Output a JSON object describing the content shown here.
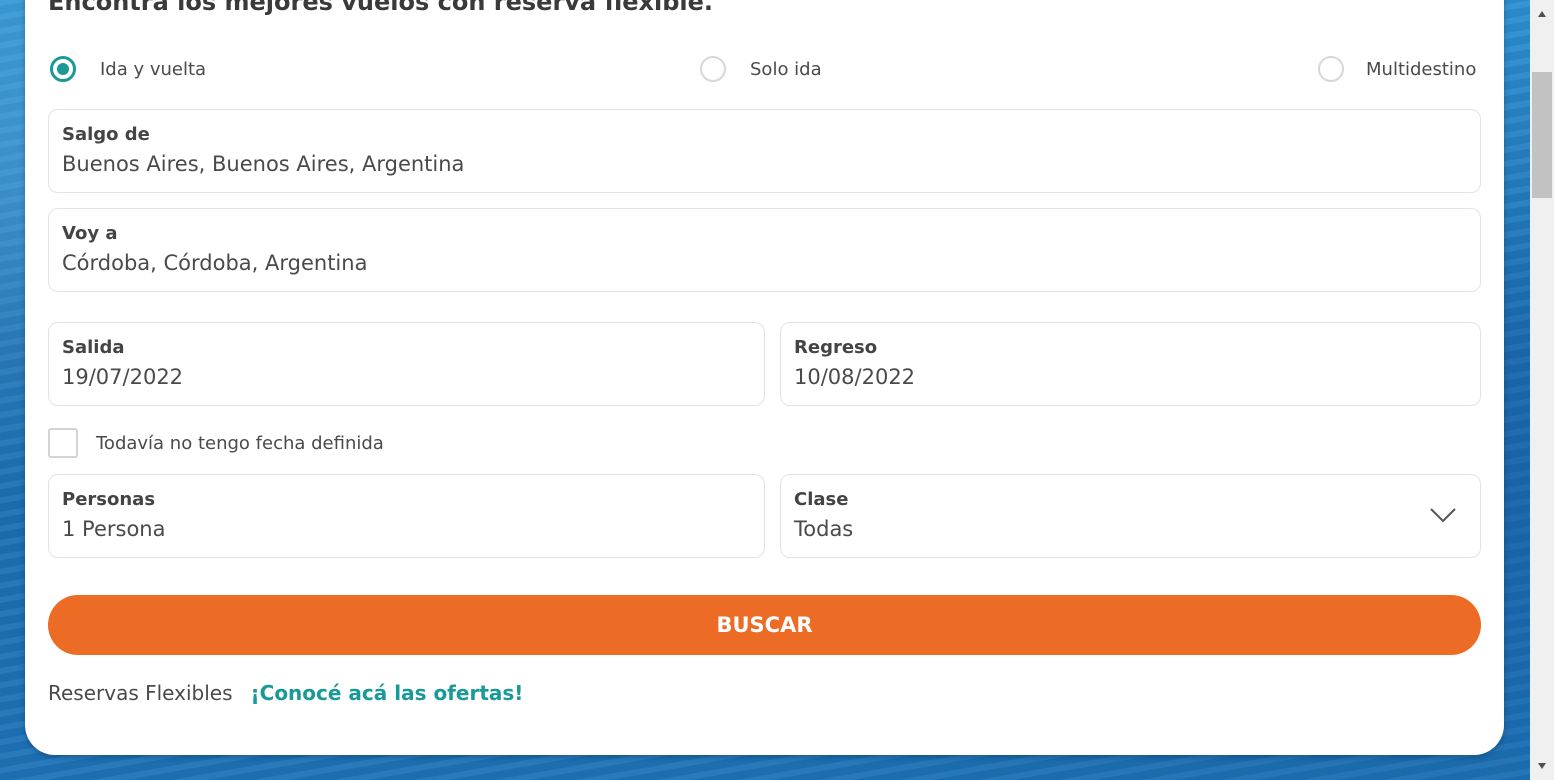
{
  "page": {
    "heading": "Encontrá los mejores vuelos con reserva flexible."
  },
  "trip_type": {
    "options": [
      {
        "label": "Ida y vuelta",
        "selected": true
      },
      {
        "label": "Solo ida",
        "selected": false
      },
      {
        "label": "Multidestino",
        "selected": false
      }
    ]
  },
  "form": {
    "origin": {
      "label": "Salgo de",
      "value": "Buenos Aires, Buenos Aires, Argentina"
    },
    "destination": {
      "label": "Voy a",
      "value": "Córdoba, Córdoba, Argentina"
    },
    "departure": {
      "label": "Salida",
      "value": "19/07/2022"
    },
    "return": {
      "label": "Regreso",
      "value": "10/08/2022"
    },
    "no_date": {
      "label": "Todavía no tengo fecha definida",
      "checked": false
    },
    "people": {
      "label": "Personas",
      "value": "1 Persona"
    },
    "class": {
      "label": "Clase",
      "value": "Todas"
    },
    "search_button": "BUSCAR"
  },
  "footer": {
    "text": "Reservas Flexibles",
    "link": "¡Conocé acá las ofertas!"
  },
  "colors": {
    "accent_teal": "#1a9999",
    "button_orange": "#ec6c26",
    "text_dark": "#4a4a4a"
  },
  "icons": {
    "class_dropdown": "chevron-down-icon",
    "scroll_up": "scroll-up-arrow-icon",
    "scroll_down": "scroll-down-arrow-icon"
  }
}
